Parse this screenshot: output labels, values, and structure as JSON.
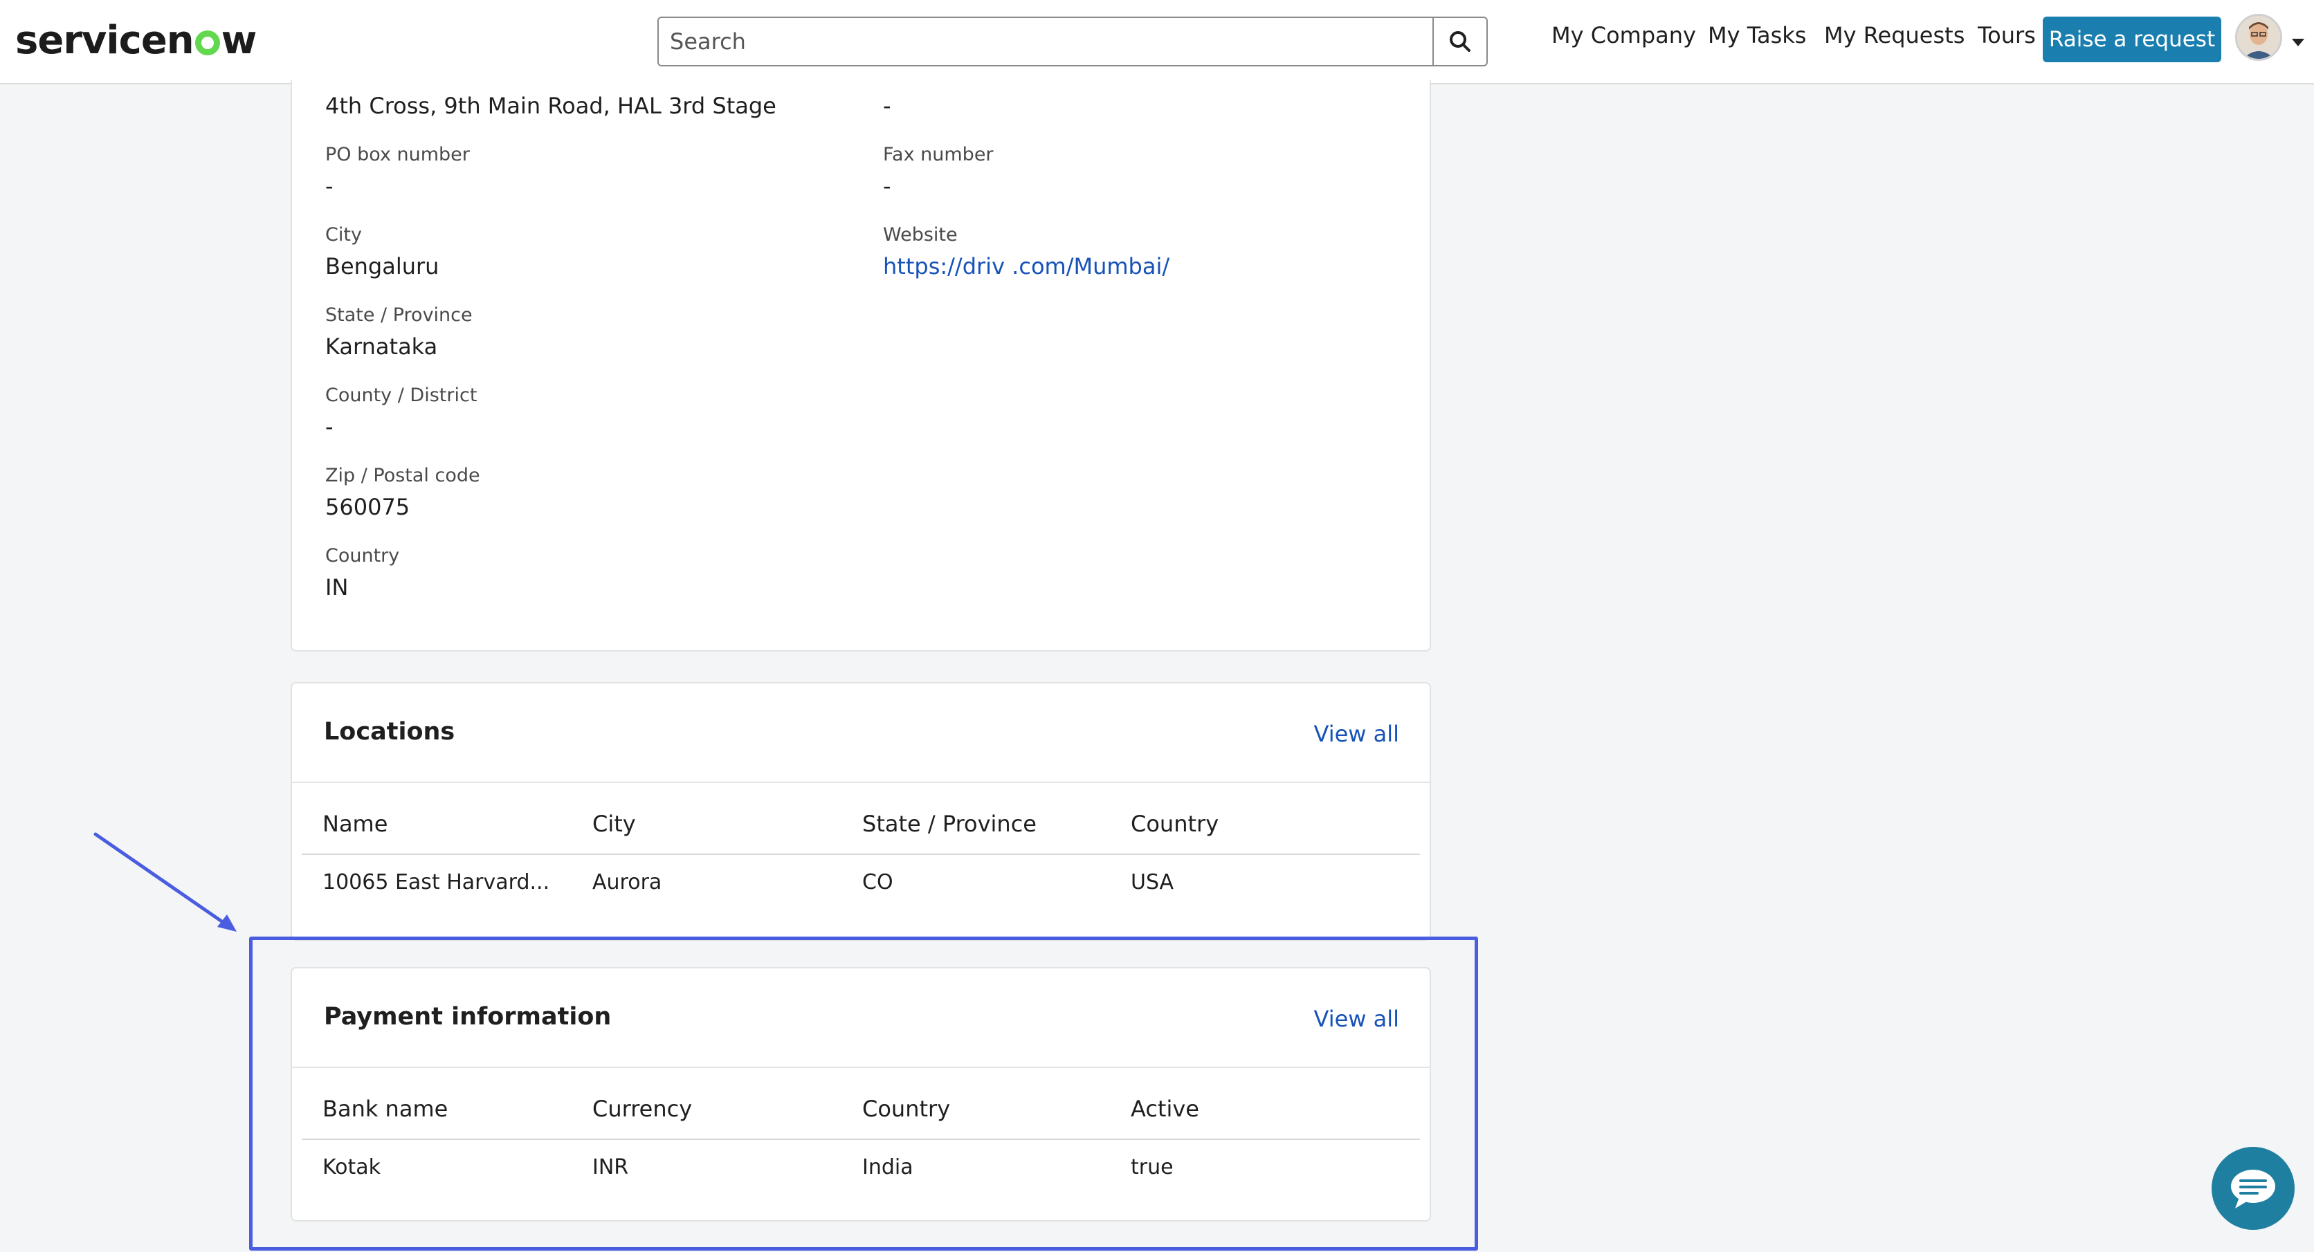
{
  "header": {
    "logo_text_a": "servicen",
    "logo_text_b": "w",
    "search_placeholder": "Search",
    "nav": [
      "My Company",
      "My Tasks",
      "My Requests",
      "Tours"
    ],
    "raise_request_label": "Raise a request"
  },
  "address": {
    "address_line": "4th Cross, 9th Main Road, HAL 3rd Stage",
    "address_line_right": "-",
    "po_box_label": "PO box number",
    "po_box_value": "-",
    "fax_label": "Fax number",
    "fax_value": "-",
    "city_label": "City",
    "city_value": "Bengaluru",
    "website_label": "Website",
    "website_value": "https://driv    .com/Mumbai/",
    "state_label": "State / Province",
    "state_value": "Karnataka",
    "county_label": "County / District",
    "county_value": "-",
    "zip_label": "Zip / Postal code",
    "zip_value": "560075",
    "country_label": "Country",
    "country_value": "IN"
  },
  "locations": {
    "title": "Locations",
    "view_all": "View all",
    "columns": [
      "Name",
      "City",
      "State / Province",
      "Country"
    ],
    "rows": [
      {
        "name": "10065 East Harvard...",
        "city": "Aurora",
        "state": "CO",
        "country": "USA"
      }
    ]
  },
  "payment": {
    "title": "Payment information",
    "view_all": "View all",
    "columns": [
      "Bank name",
      "Currency",
      "Country",
      "Active"
    ],
    "rows": [
      {
        "bank": "Kotak",
        "currency": "INR",
        "country": "India",
        "active": "true"
      }
    ]
  },
  "colors": {
    "accent": "#1a7faf",
    "link": "#1652b8",
    "annotation": "#4a5cdf",
    "logo_green": "#62d84e",
    "chat": "#1f7fa0"
  },
  "icons": [
    "search-icon",
    "avatar",
    "chevron-down-icon",
    "chat-icon",
    "annotation-arrow"
  ]
}
